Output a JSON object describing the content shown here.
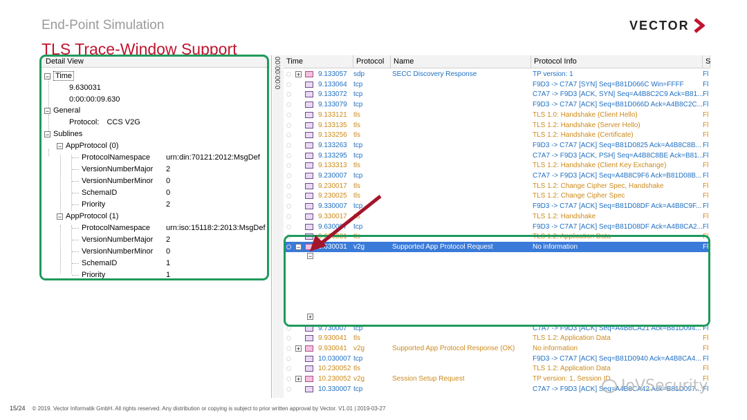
{
  "slide": {
    "subtitle": "End-Point Simulation",
    "title": "TLS Trace-Window Support",
    "logo_text": "VECTOR",
    "brand_color": "#c0142f",
    "page": "15/24",
    "copyright": "© 2019. Vector Informatik GmbH. All rights reserved. Any distribution or copying is subject to prior written approval by Vector. V1.01 | 2019-03-27",
    "watermark": "IoVSecurity"
  },
  "detail_view": {
    "header": "Detail View",
    "time_label": "Time",
    "time_value": "9.630031",
    "time_clock": "0:00:00:09.630",
    "general_label": "General",
    "protocol_label": "Protocol:",
    "protocol_value": "CCS V2G",
    "sublines_label": "Sublines",
    "app0": {
      "label": "AppProtocol (0)",
      "fields": [
        {
          "name": "ProtocolNamespace",
          "value": "urn:din:70121:2012:MsgDef"
        },
        {
          "name": "VersionNumberMajor",
          "value": "2"
        },
        {
          "name": "VersionNumberMinor",
          "value": "0"
        },
        {
          "name": "SchemaID",
          "value": "0"
        },
        {
          "name": "Priority",
          "value": "2"
        }
      ]
    },
    "app1": {
      "label": "AppProtocol (1)",
      "fields": [
        {
          "name": "ProtocolNamespace",
          "value": "urn:iso:15118:2:2013:MsgDef"
        },
        {
          "name": "VersionNumberMajor",
          "value": "2"
        },
        {
          "name": "VersionNumberMinor",
          "value": "0"
        },
        {
          "name": "SchemaID",
          "value": "1"
        },
        {
          "name": "Priority",
          "value": "1"
        }
      ]
    }
  },
  "trace": {
    "splitter_label": "0:00:00:00",
    "columns": {
      "time": "Time",
      "protocol": "Protocol",
      "name": "Name",
      "info": "Protocol Info",
      "s": "S"
    },
    "rows": [
      {
        "time": "9.133057",
        "proto": "sdp",
        "name": "SECC Discovery Response",
        "info": "TP version: 1",
        "s": "Fl",
        "color": "blue",
        "expand": "+",
        "icon": "msg"
      },
      {
        "time": "9.133064",
        "proto": "tcp",
        "name": "",
        "info": "F9D3 -> C7A7 [SYN] Seq=B81D066C Win=FFFF",
        "s": "Fl",
        "color": "blue"
      },
      {
        "time": "9.133072",
        "proto": "tcp",
        "name": "",
        "info": "C7A7 -> F9D3 [ACK, SYN] Seq=A4B8C2C9 Ack=B81...",
        "s": "Fl",
        "color": "blue"
      },
      {
        "time": "9.133079",
        "proto": "tcp",
        "name": "",
        "info": "F9D3 -> C7A7 [ACK] Seq=B81D066D Ack=A4B8C2C...",
        "s": "Fl",
        "color": "blue"
      },
      {
        "time": "9.133121",
        "proto": "tls",
        "name": "",
        "info": "TLS 1.0: Handshake (Client Hello)",
        "s": "Fl",
        "color": "orange"
      },
      {
        "time": "9.133135",
        "proto": "tls",
        "name": "",
        "info": "TLS 1.2: Handshake (Server Hello)",
        "s": "Fl",
        "color": "orange"
      },
      {
        "time": "9.133256",
        "proto": "tls",
        "name": "",
        "info": "TLS 1.2: Handshake (Certificate)",
        "s": "Fl",
        "color": "orange"
      },
      {
        "time": "9.133263",
        "proto": "tcp",
        "name": "",
        "info": "F9D3 -> C7A7 [ACK] Seq=B81D0825 Ack=A4B8C8B...",
        "s": "Fl",
        "color": "blue"
      },
      {
        "time": "9.133295",
        "proto": "tcp",
        "name": "",
        "info": "C7A7 -> F9D3 [ACK, PSH] Seq=A4B8C8BE Ack=B81...",
        "s": "Fl",
        "color": "blue"
      },
      {
        "time": "9.133313",
        "proto": "tls",
        "name": "",
        "info": "TLS 1.2: Handshake (Client Key Exchange)",
        "s": "Fl",
        "color": "orange"
      },
      {
        "time": "9.230007",
        "proto": "tcp",
        "name": "",
        "info": "C7A7 -> F9D3 [ACK] Seq=A4B8C9F6 Ack=B81D08B...",
        "s": "Fl",
        "color": "blue"
      },
      {
        "time": "9.230017",
        "proto": "tls",
        "name": "",
        "info": "TLS 1.2: Change Cipher Spec, Handshake",
        "s": "Fl",
        "color": "orange"
      },
      {
        "time": "9.230025",
        "proto": "tls",
        "name": "",
        "info": "TLS 1.2: Change Cipher Spec",
        "s": "Fl",
        "color": "orange"
      },
      {
        "time": "9.330007",
        "proto": "tcp",
        "name": "",
        "info": "F9D3 -> C7A7 [ACK] Seq=B81D08DF Ack=A4B8C9F...",
        "s": "Fl",
        "color": "blue"
      },
      {
        "time": "9.330017",
        "proto": "tls",
        "name": "",
        "info": "TLS 1.2: Handshake",
        "s": "Fl",
        "color": "orange"
      },
      {
        "time": "9.630007",
        "proto": "tcp",
        "name": "",
        "info": "F9D3 -> C7A7 [ACK] Seq=B81D08DF Ack=A4B8CA2...",
        "s": "Fl",
        "color": "blue"
      },
      {
        "time": "9.630031",
        "proto": "tls",
        "name": "",
        "info": "TLS 1.2: Application Data",
        "s": "Fl",
        "color": "orange"
      }
    ],
    "selected": {
      "time": "9.630031",
      "proto": "v2g",
      "name": "Supported App Protocol Request",
      "info": "No information",
      "s": "Fl"
    },
    "sub_app0_label": "AppProtocol (0)",
    "sub_fields": [
      {
        "name": "ProtocolNamespace",
        "value": "urn:din:70121:2012:MsgDef"
      },
      {
        "name": "VersionNumberMajor",
        "value": "2"
      },
      {
        "name": "VersionNumberMinor",
        "value": "0"
      },
      {
        "name": "SchemaID",
        "value": "0"
      },
      {
        "name": "Priority",
        "value": "2"
      }
    ],
    "sub_app1_label": "AppProtocol (1)",
    "rows_after": [
      {
        "time": "9.730007",
        "proto": "tcp",
        "name": "",
        "info": "C7A7 -> F9D3 [ACK] Seq=A4B8CA21 Ack=B81D094...",
        "s": "Fl",
        "color": "blue"
      },
      {
        "time": "9.930041",
        "proto": "tls",
        "name": "",
        "info": "TLS 1.2: Application Data",
        "s": "Fl",
        "color": "orange"
      },
      {
        "time": "9.930041",
        "proto": "v2g",
        "name": "Supported App Protocol Response (OK)",
        "info": "No information",
        "s": "Fl",
        "color": "orange",
        "expand": "+",
        "icon": "msg"
      },
      {
        "time": "10.030007",
        "proto": "tcp",
        "name": "",
        "info": "F9D3 -> C7A7 [ACK] Seq=B81D0940 Ack=A4B8CA4...",
        "s": "Fl",
        "color": "blue"
      },
      {
        "time": "10.230052",
        "proto": "tls",
        "name": "",
        "info": "TLS 1.2: Application Data",
        "s": "Fl",
        "color": "orange"
      },
      {
        "time": "10.230052",
        "proto": "v2g",
        "name": "Session Setup Request",
        "info": "TP version: 1, Session ID",
        "s": "Fl",
        "color": "orange",
        "expand": "+",
        "icon": "msg"
      },
      {
        "time": "10.330007",
        "proto": "tcp",
        "name": "",
        "info": "C7A7 -> F9D3 [ACK] Seq=A4B8CA42 Ack=B81D097...",
        "s": "Fl",
        "color": "blue"
      }
    ]
  }
}
